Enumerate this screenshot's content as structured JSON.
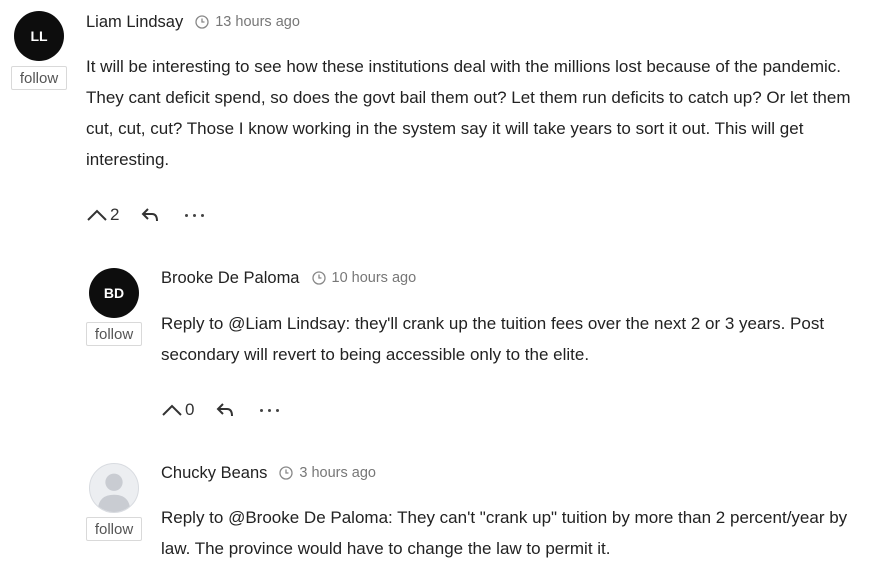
{
  "comments": [
    {
      "initials": "LL",
      "author": "Liam Lindsay",
      "time": "13 hours ago",
      "follow_label": "follow",
      "text": "It will be interesting to see how these institutions deal with the millions lost because of the pandemic. They cant deficit spend, so does the govt bail them out? Let them run deficits to catch up? Or let them cut, cut, cut? Those I know working in the system say it will take years to sort it out. This will get interesting.",
      "upvotes": "2"
    },
    {
      "initials": "BD",
      "author": "Brooke De Paloma",
      "time": "10 hours ago",
      "follow_label": "follow",
      "text": "Reply to @Liam Lindsay: they'll crank up the tuition fees over the next 2 or 3 years. Post secondary will revert to being accessible only to the elite.",
      "upvotes": "0"
    },
    {
      "initials": "",
      "author": "Chucky Beans",
      "time": "3 hours ago",
      "follow_label": "follow",
      "text": "Reply to @Brooke De Paloma: They can't \"crank up\" tuition by more than 2 percent/year by law. The province would have to change the law to permit it."
    }
  ],
  "icons": {
    "clock": "clock-icon",
    "upvote": "chevron-up-icon",
    "reply": "reply-icon",
    "more": "more-icon",
    "avatar_placeholder": "user-silhouette-icon"
  },
  "colors": {
    "avatar_bg": "#0d0d0d",
    "meta_text": "#777777",
    "body_text": "#222222"
  }
}
